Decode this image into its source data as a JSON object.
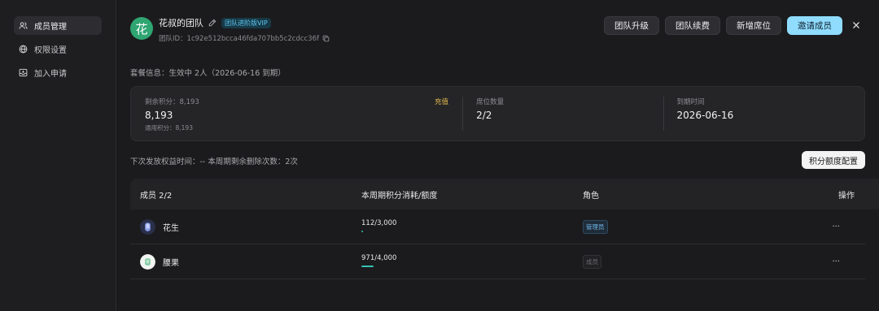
{
  "sidebar": {
    "items": [
      {
        "label": "成员管理",
        "icon": "members-icon",
        "active": true
      },
      {
        "label": "权限设置",
        "icon": "globe-icon",
        "active": false
      },
      {
        "label": "加入申请",
        "icon": "inbox-icon",
        "active": false
      }
    ]
  },
  "team": {
    "avatar_char": "花",
    "name": "花叔的团队",
    "badge": "团队进阶版VIP",
    "id_label": "团队ID：1c92e512bcca46fda707bb5c2cdcc36f"
  },
  "actions": {
    "upgrade": "团队升级",
    "renew": "团队续费",
    "add_seat": "新增席位",
    "invite": "邀请成员"
  },
  "plan_info": "套餐信息：生效中 2人（2026-06-16 到期）",
  "stats": {
    "points_label": "剩余积分：8,193",
    "points_value": "8,193",
    "points_sub": "通用积分：8,193",
    "recharge": "充值",
    "seats_label": "席位数量",
    "seats_value": "2/2",
    "expiry_label": "到期时间",
    "expiry_value": "2026-06-16"
  },
  "next_info": "下次发放权益时间：-- 本周期剩余删除次数：2次",
  "quota_button": "积分额度配置",
  "table": {
    "headers": {
      "member": "成员 2/2",
      "usage": "本周期积分消耗/额度",
      "role": "角色",
      "op": "操作"
    },
    "rows": [
      {
        "name": "花生",
        "usage": "112/3,000",
        "usage_fraction": 0.0373,
        "role": "管理员",
        "role_type": "admin",
        "more": "···"
      },
      {
        "name": "腰果",
        "usage": "971/4,000",
        "usage_fraction": 0.2428,
        "role": "成员",
        "role_type": "member",
        "more": "···"
      }
    ]
  },
  "colors": {
    "accent": "#8fdcff",
    "avatar_green": "#2fa572",
    "recharge": "#e2b84e",
    "progress": "#36c1b3",
    "vip": "#5fc9f3"
  }
}
